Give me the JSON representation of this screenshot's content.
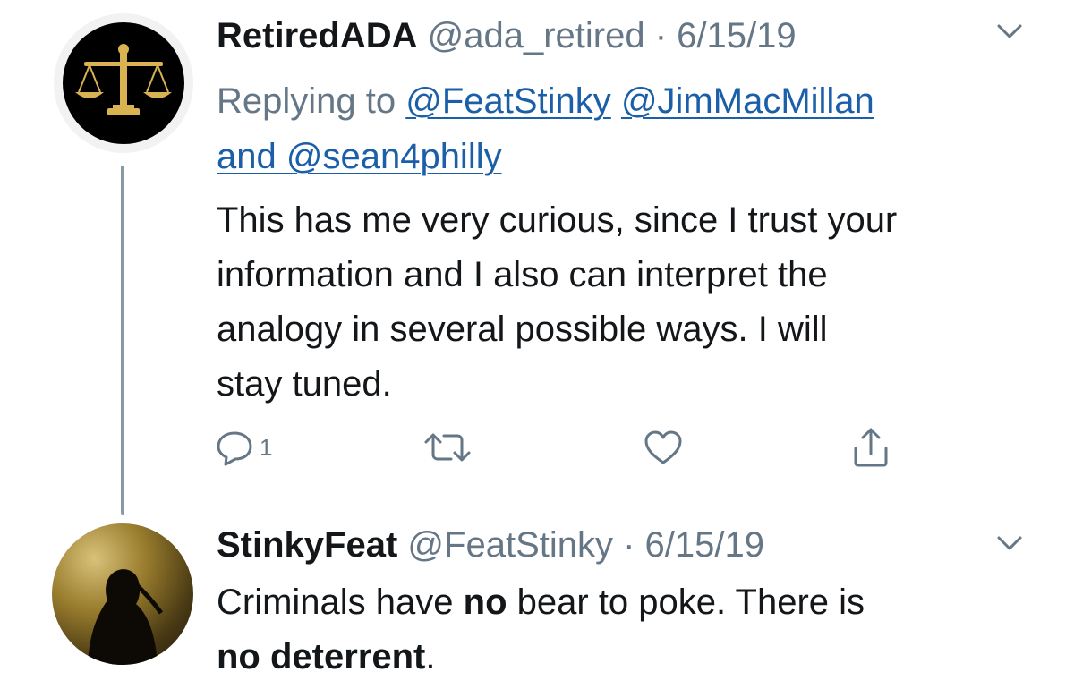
{
  "tweet1": {
    "display_name": "RetiredADA",
    "handle": "@ada_retired",
    "separator": " · ",
    "date": "6/15/19",
    "replying_prefix": "Replying to ",
    "mention1": "@FeatStinky",
    "mention2": "@JimMacMillan",
    "mention3_joined": "and @sean4philly",
    "body_lines": [
      "This has me very curious, since I trust your",
      "information and I also can interpret the",
      "analogy in several possible ways.  I will",
      "stay tuned."
    ],
    "reply_count": "1",
    "avatar_icon": "scales-of-justice-icon"
  },
  "tweet2": {
    "display_name": "StinkyFeat",
    "handle": "@FeatStinky",
    "separator": " · ",
    "date": "6/15/19",
    "body": {
      "l1_a": "Criminals have ",
      "l1_b": "no",
      "l1_c": " bear to poke. There is",
      "l2_a": "no deterrent",
      "l2_b": "."
    }
  },
  "icons": {
    "menu": "chevron-down-icon",
    "reply": "reply-bubble-icon",
    "retweet": "retweet-icon",
    "like": "heart-icon",
    "share": "share-icon"
  },
  "colors": {
    "text": "#14171a",
    "muted": "#657786",
    "link": "#1b5fa8",
    "thread_line": "#8899a6",
    "icon_gray": "#657786"
  }
}
